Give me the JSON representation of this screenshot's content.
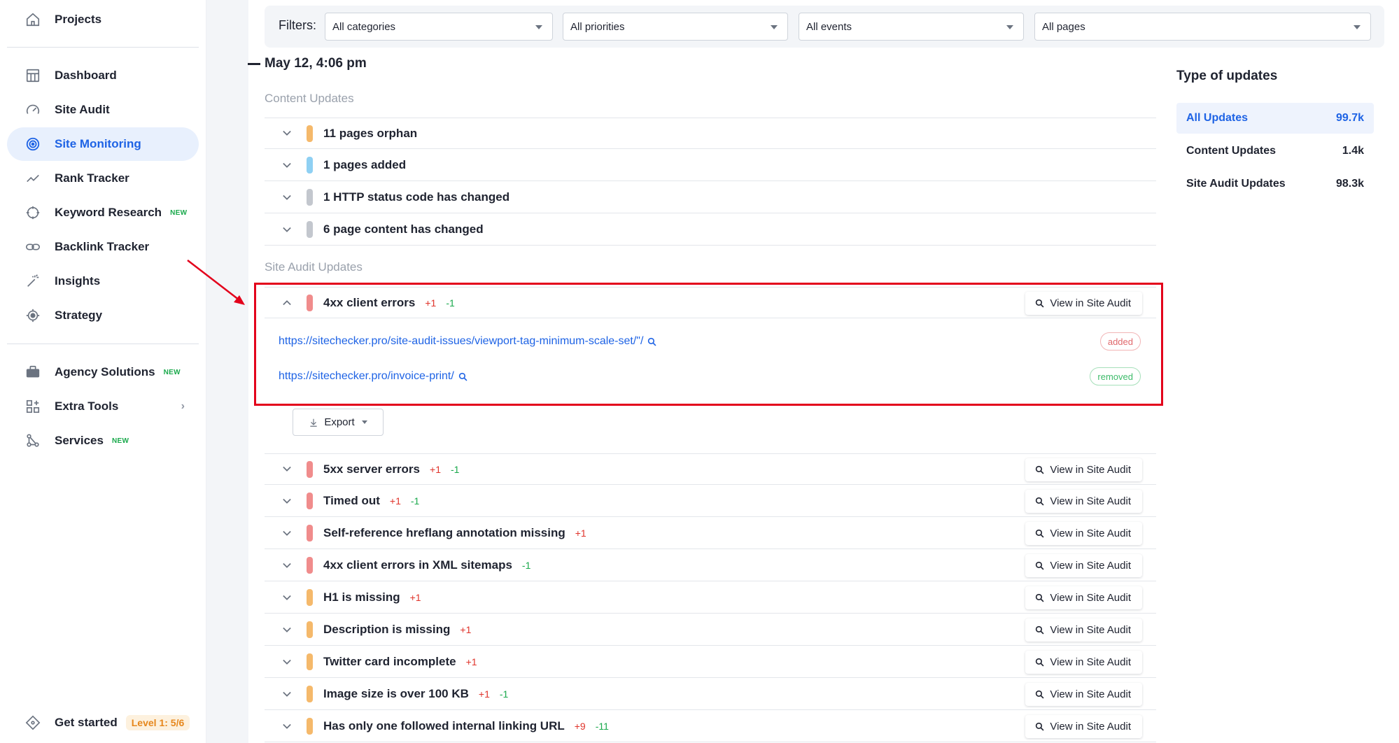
{
  "sidebar": {
    "projects": "Projects",
    "items": [
      {
        "label": "Dashboard",
        "icon": "dashboard-icon"
      },
      {
        "label": "Site Audit",
        "icon": "gauge-icon"
      },
      {
        "label": "Site Monitoring",
        "icon": "radar-icon",
        "active": true
      },
      {
        "label": "Rank Tracker",
        "icon": "trend-line-icon"
      },
      {
        "label": "Keyword Research",
        "icon": "target-icon",
        "badge": "NEW"
      },
      {
        "label": "Backlink Tracker",
        "icon": "link-icon"
      },
      {
        "label": "Insights",
        "icon": "magic-wand-icon"
      },
      {
        "label": "Strategy",
        "icon": "crosshair-icon"
      }
    ],
    "tools": [
      {
        "label": "Agency Solutions",
        "icon": "briefcase-icon",
        "badge": "NEW"
      },
      {
        "label": "Extra Tools",
        "icon": "grid-plus-icon"
      },
      {
        "label": "Services",
        "icon": "nodes-icon",
        "badge": "NEW"
      }
    ],
    "get_started": "Get started",
    "level": "Level 1: 5/6"
  },
  "filters": {
    "label": "Filters:",
    "categories": "All categories",
    "priorities": "All priorities",
    "events": "All events",
    "pages": "All pages"
  },
  "date": "May 12, 4:06 pm",
  "content_updates": {
    "label": "Content Updates",
    "rows": [
      {
        "text": "11 pages orphan",
        "color": "#f5b96b"
      },
      {
        "text": "1 pages added",
        "color": "#8fd0f3"
      },
      {
        "text": "1 HTTP status code has changed",
        "color": "#c3c7ce"
      },
      {
        "text": "6 page content has changed",
        "color": "#c3c7ce"
      }
    ]
  },
  "site_audit_updates": {
    "label": "Site Audit Updates",
    "view_label": "View in Site Audit",
    "expanded": {
      "text": "4xx client errors",
      "plus": "+1",
      "minus": "-1",
      "urls": [
        {
          "url": "https://sitechecker.pro/site-audit-issues/viewport-tag-minimum-scale-set/\"/",
          "status": "added"
        },
        {
          "url": "https://sitechecker.pro/invoice-print/",
          "status": "removed"
        }
      ]
    },
    "export_label": "Export",
    "rows": [
      {
        "text": "5xx server errors",
        "plus": "+1",
        "minus": "-1",
        "color": "#f08c8c"
      },
      {
        "text": "Timed out",
        "plus": "+1",
        "minus": "-1",
        "color": "#f08c8c"
      },
      {
        "text": "Self-reference hreflang annotation missing",
        "plus": "+1",
        "minus": "",
        "color": "#f08c8c"
      },
      {
        "text": "4xx client errors in XML sitemaps",
        "plus": "",
        "minus": "-1",
        "color": "#f08c8c"
      },
      {
        "text": "H1 is missing",
        "plus": "+1",
        "minus": "",
        "color": "#f5b96b"
      },
      {
        "text": "Description is missing",
        "plus": "+1",
        "minus": "",
        "color": "#f5b96b"
      },
      {
        "text": "Twitter card incomplete",
        "plus": "+1",
        "minus": "",
        "color": "#f5b96b"
      },
      {
        "text": "Image size is over 100 KB",
        "plus": "+1",
        "minus": "-1",
        "color": "#f5b96b"
      },
      {
        "text": "Has only one followed internal linking URL",
        "plus": "+9",
        "minus": "-11",
        "color": "#f5b96b"
      }
    ]
  },
  "type_of_updates": {
    "title": "Type of updates",
    "items": [
      {
        "label": "All Updates",
        "count": "99.7k",
        "active": true
      },
      {
        "label": "Content Updates",
        "count": "1.4k"
      },
      {
        "label": "Site Audit Updates",
        "count": "98.3k"
      }
    ]
  },
  "colors": {
    "accent": "#1e63e5",
    "highlight": "#e3001b",
    "plus": "#e0342b",
    "minus": "#1aa94c"
  }
}
